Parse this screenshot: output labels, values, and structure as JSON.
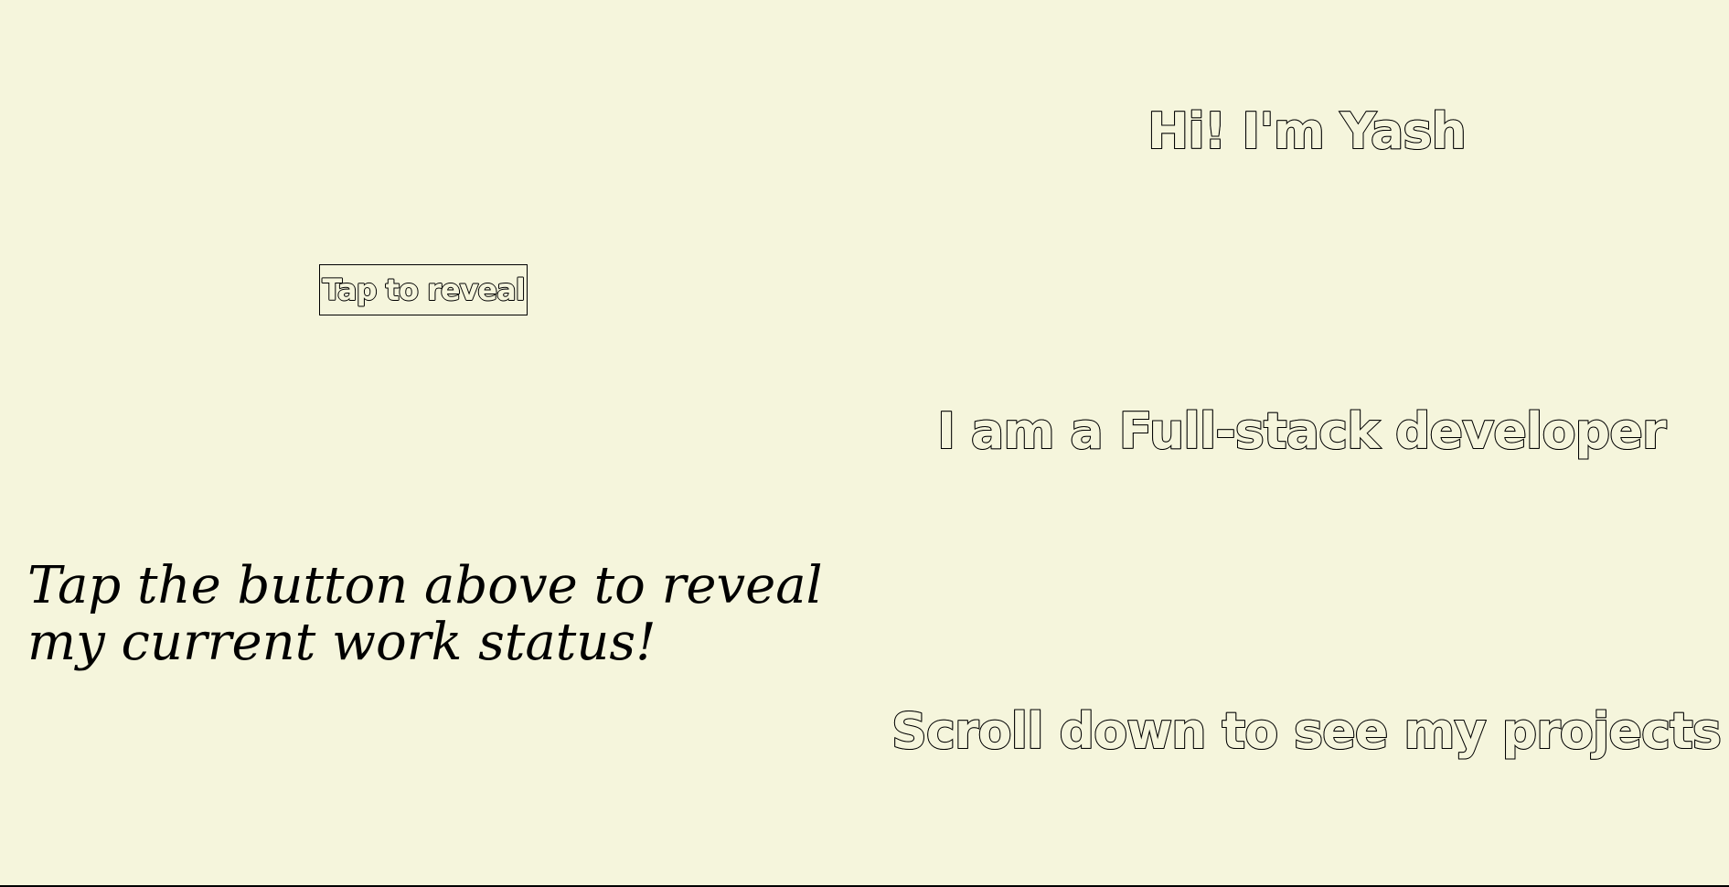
{
  "hero": {
    "greeting": "Hi! I'm Yash",
    "role": "I am a Full-stack developer",
    "scroll_hint": "Scroll down to see my projects"
  },
  "reveal": {
    "button_label": "Tap to reveal",
    "prompt_line_1": "Tap the button above to reveal",
    "prompt_line_2": "my current work status!"
  },
  "colors": {
    "background": "#f5f5dc",
    "text_outline": "#000000"
  }
}
